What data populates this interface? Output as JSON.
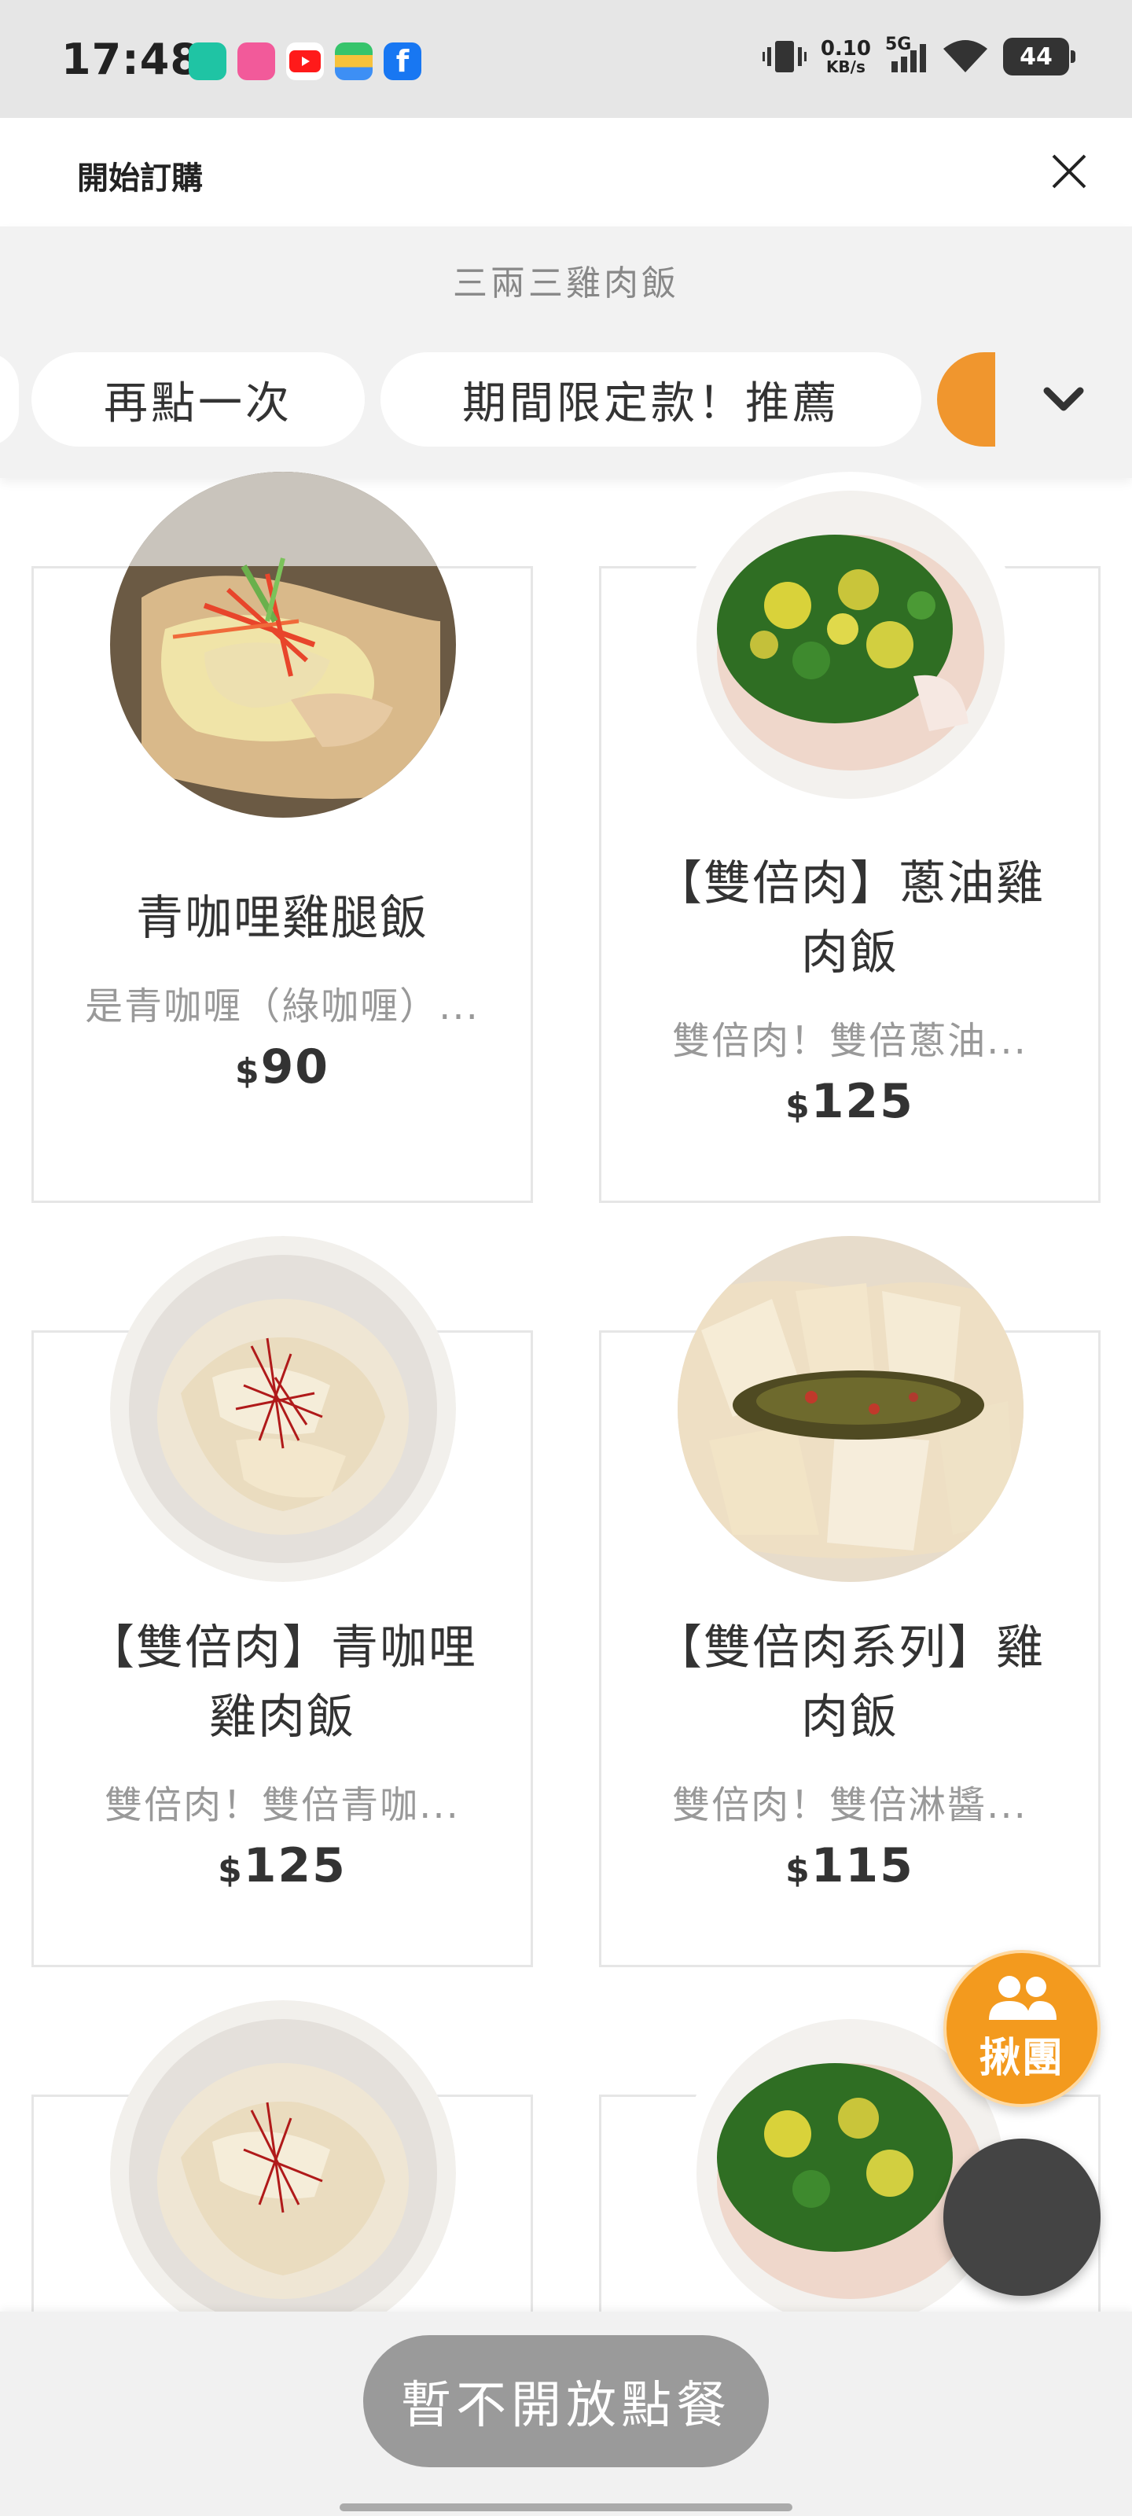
{
  "status_bar": {
    "time": "17:48",
    "speed_value": "0.10",
    "speed_unit": "KB/s",
    "network": "5G",
    "battery": "44",
    "icons": [
      "mi-home-icon",
      "lalala-icon",
      "youtube-icon",
      "wallet-icon",
      "facebook-icon",
      "vibrate-icon",
      "signal-icon",
      "wifi-icon"
    ]
  },
  "header": {
    "title": "開始訂購",
    "close_icon": "close-icon"
  },
  "store": {
    "name": "三兩三雞肉飯"
  },
  "category_tabs": [
    {
      "label": "再點一次"
    },
    {
      "label": "期間限定款！推薦"
    }
  ],
  "products": [
    {
      "name": "青咖哩雞腿飯",
      "description": "是青咖喱（綠咖喱）...",
      "currency": "$",
      "price": "90"
    },
    {
      "name": "【雙倍肉】蔥油雞肉飯",
      "name_line1": "【雙倍肉】蔥油雞",
      "name_line2": "肉飯",
      "description": "雙倍肉！雙倍蔥油...",
      "currency": "$",
      "price": "125"
    },
    {
      "name": "【雙倍肉】青咖哩雞肉飯",
      "name_line1": "【雙倍肉】青咖哩",
      "name_line2": "雞肉飯",
      "description": "雙倍肉！雙倍青咖...",
      "currency": "$",
      "price": "125"
    },
    {
      "name": "【雙倍肉系列】雞肉飯",
      "name_line1": "【雙倍肉系列】雞",
      "name_line2": "肉飯",
      "description": "雙倍肉！雙倍淋醬...",
      "currency": "$",
      "price": "115"
    }
  ],
  "fab": {
    "group_label": "揪團"
  },
  "bottom": {
    "order_button": "暫不開放點餐"
  },
  "colors": {
    "accent": "#f39a1e",
    "disabled_button": "#9a9a9a",
    "store_bar": "#f2f2f2"
  }
}
